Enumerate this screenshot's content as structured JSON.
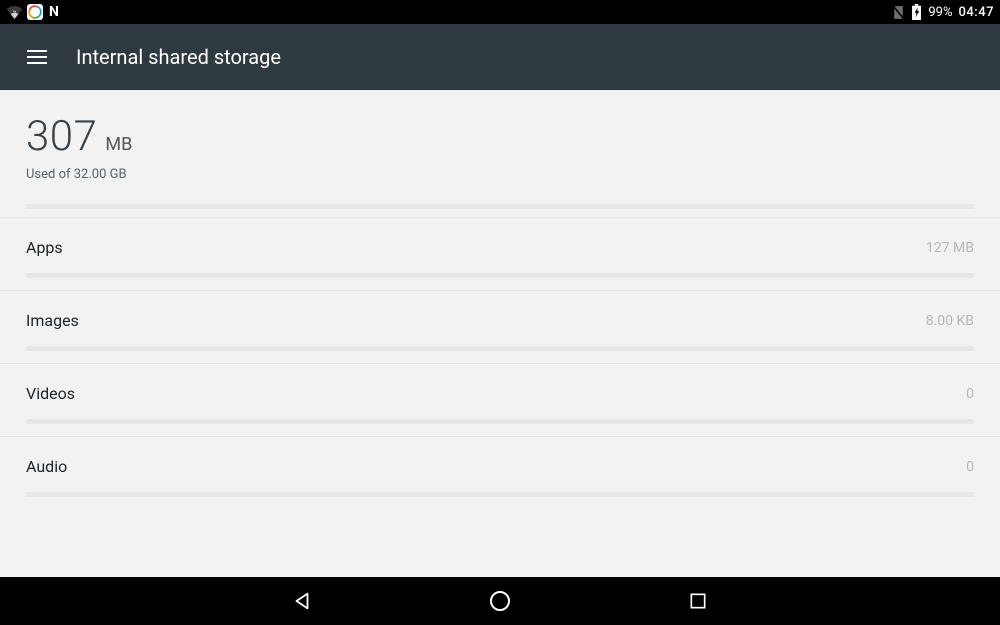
{
  "status": {
    "battery_pct": "99%",
    "time": "04:47",
    "n_glyph": "N"
  },
  "appbar": {
    "title": "Internal shared storage"
  },
  "summary": {
    "used_value": "307",
    "used_unit": "MB",
    "used_of": "Used of 32.00 GB"
  },
  "rows": [
    {
      "label": "Apps",
      "value": "127 MB"
    },
    {
      "label": "Images",
      "value": "8.00 KB"
    },
    {
      "label": "Videos",
      "value": "0"
    },
    {
      "label": "Audio",
      "value": "0"
    }
  ]
}
